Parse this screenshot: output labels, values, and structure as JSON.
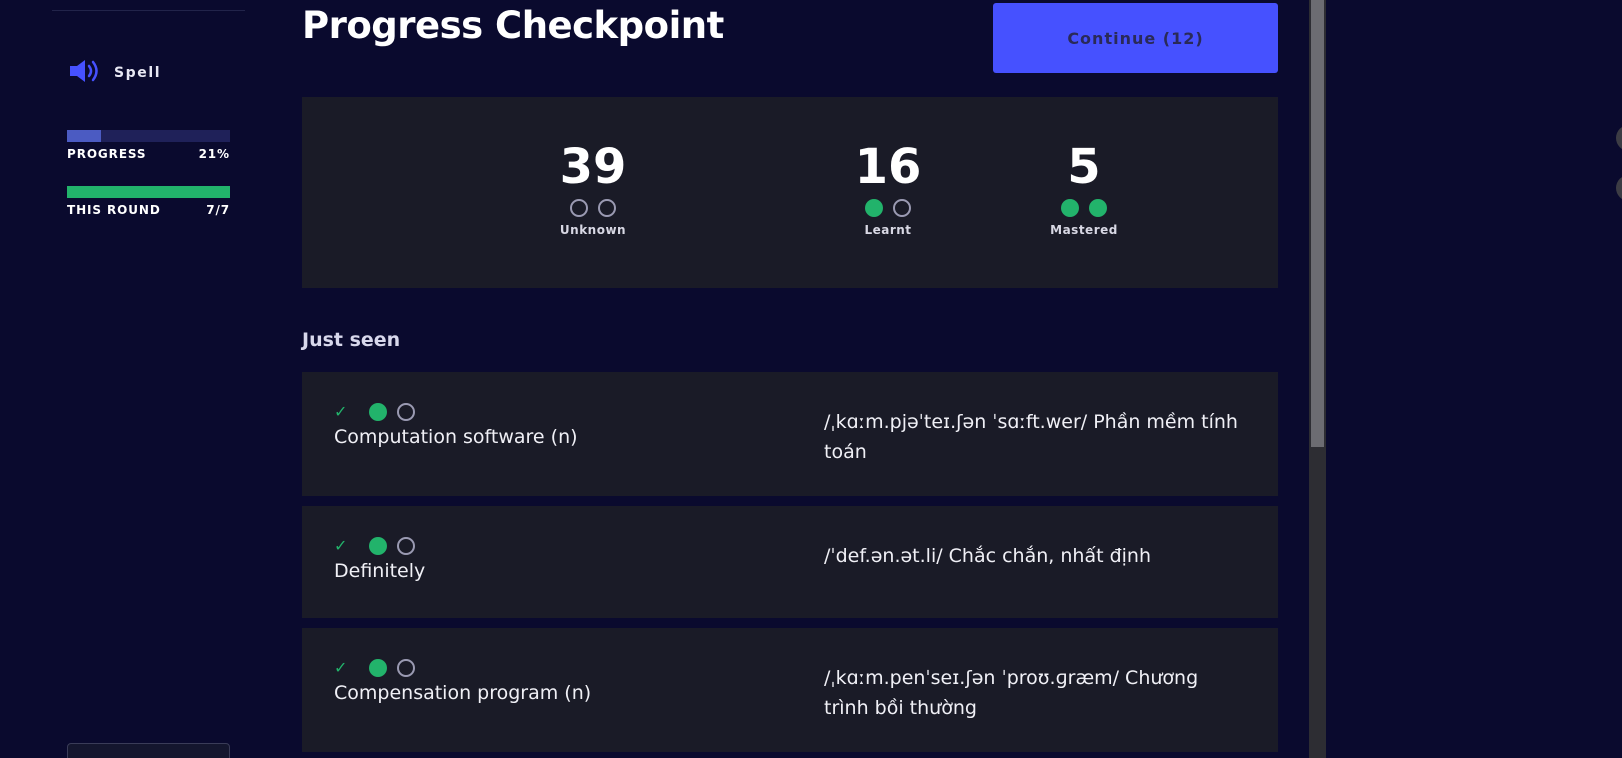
{
  "sidebar": {
    "spell_label": "Spell",
    "progress": {
      "label": "PROGRESS",
      "value_text": "21%",
      "fraction": 0.21,
      "color": "#4b5bc2",
      "track_color": "#1f2159"
    },
    "round": {
      "label": "THIS ROUND",
      "value_text": "7/7",
      "fraction": 1.0,
      "color": "#22b36b"
    }
  },
  "header": {
    "title": "Progress Checkpoint",
    "continue_label": "Continue (12)",
    "accent_color": "#4651ff"
  },
  "stats": [
    {
      "number": "39",
      "label": "Unknown",
      "dots_filled": 0
    },
    {
      "number": "16",
      "label": "Learnt",
      "dots_filled": 1
    },
    {
      "number": "5",
      "label": "Mastered",
      "dots_filled": 2
    }
  ],
  "just_seen": {
    "title": "Just seen",
    "items": [
      {
        "term": "Computation software (n)",
        "definition": "/ˌkɑːm.pjəˈteɪ.ʃən ˈsɑːft.wer/ Phần mềm tính toán",
        "dots_filled": 1
      },
      {
        "term": "Definitely",
        "definition": "/ˈdef.ən.ət.li/ Chắc chắn, nhất định",
        "dots_filled": 1
      },
      {
        "term": "Compensation program (n)",
        "definition": "/ˌkɑːm.penˈseɪ.ʃən ˈproʊ.ɡræm/ Chương trình bồi thường",
        "dots_filled": 1
      }
    ]
  },
  "colors": {
    "background": "#0a0a2e",
    "card": "#1a1b27",
    "mastered_green": "#22b36b"
  }
}
